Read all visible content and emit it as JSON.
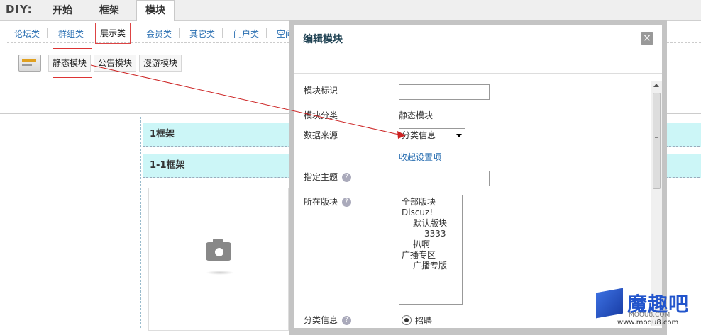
{
  "diy": {
    "label": "DIY:",
    "tabs": [
      {
        "label": "开始"
      },
      {
        "label": "框架"
      },
      {
        "label": "模块"
      }
    ]
  },
  "categories": [
    {
      "label": "论坛类"
    },
    {
      "label": "群组类"
    },
    {
      "label": "展示类"
    },
    {
      "label": "会员类"
    },
    {
      "label": "其它类"
    },
    {
      "label": "门户类"
    },
    {
      "label": "空间类"
    }
  ],
  "modules": [
    {
      "label": "静态模块"
    },
    {
      "label": "公告模块"
    },
    {
      "label": "漫游模块"
    }
  ],
  "frames": [
    {
      "label": "1框架"
    },
    {
      "label": "1-1框架"
    }
  ],
  "dialog": {
    "title": "编辑模块",
    "close_label": "×",
    "fields": {
      "block_id": {
        "label": "模块标识",
        "value": ""
      },
      "block_category": {
        "label": "模块分类",
        "value": "静态模块"
      },
      "data_source": {
        "label": "数据来源",
        "selected": "分类信息"
      },
      "collapse_link": "收起设置项",
      "theme": {
        "label": "指定主题",
        "value": ""
      },
      "forum": {
        "label": "所在版块"
      },
      "classified": {
        "label": "分类信息",
        "option": "招聘"
      }
    },
    "forum_options": [
      "全部版块",
      "Discuz!",
      "默认版块",
      "3333",
      "扒啊",
      "广播专区",
      "广播专版"
    ],
    "help_glyph": "?"
  },
  "watermark": {
    "brand": "魔趣吧",
    "sub": "MOQU8.COM",
    "url": "www.moqu8.com"
  }
}
